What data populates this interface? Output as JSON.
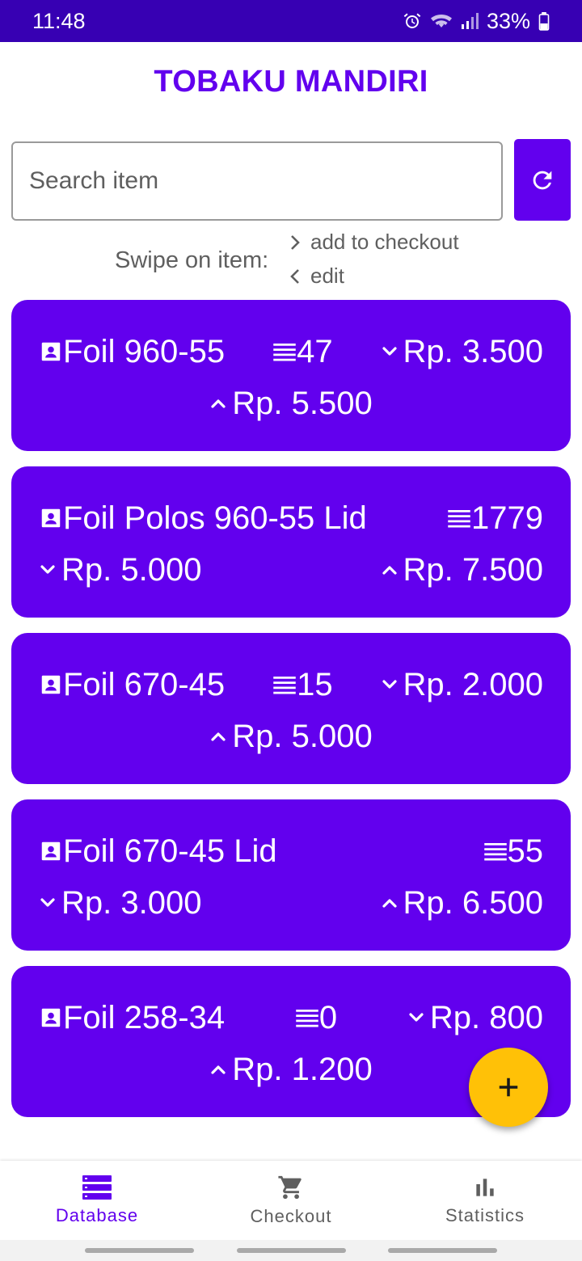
{
  "status_bar": {
    "time": "11:48",
    "battery": "33%",
    "icons": [
      "alarm-icon",
      "wifi-icon",
      "signal-icon",
      "battery-icon"
    ]
  },
  "app": {
    "title": "TOBAKU MANDIRI"
  },
  "search": {
    "placeholder": "Search item"
  },
  "hint": {
    "label": "Swipe on item:",
    "right_action": "add to checkout",
    "left_action": "edit"
  },
  "items": [
    {
      "name": "Foil 960-55",
      "stock": "47",
      "buy_price": "Rp. 3.500",
      "sell_price": "Rp. 5.500"
    },
    {
      "name": "Foil Polos 960-55 Lid",
      "stock": "1779",
      "buy_price": "Rp. 5.000",
      "sell_price": "Rp. 7.500"
    },
    {
      "name": "Foil 670-45",
      "stock": "15",
      "buy_price": "Rp. 2.000",
      "sell_price": "Rp. 5.000"
    },
    {
      "name": "Foil 670-45 Lid",
      "stock": "55",
      "buy_price": "Rp. 3.000",
      "sell_price": "Rp. 6.500"
    },
    {
      "name": "Foil 258-34",
      "stock": "0",
      "buy_price": "Rp. 800",
      "sell_price": "Rp. 1.200"
    }
  ],
  "nav": {
    "items": [
      {
        "label": "Database",
        "icon": "database-icon",
        "active": true
      },
      {
        "label": "Checkout",
        "icon": "cart-icon",
        "active": false
      },
      {
        "label": "Statistics",
        "icon": "bar-chart-icon",
        "active": false
      }
    ]
  },
  "colors": {
    "primary": "#6200ee",
    "status_bar": "#3700b3",
    "fab": "#ffc107"
  }
}
